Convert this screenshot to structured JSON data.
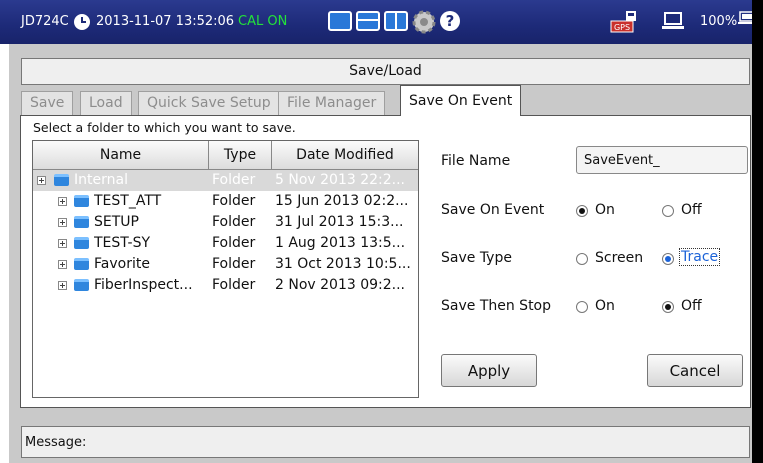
{
  "statusbar": {
    "model": "JD724C",
    "datetime": "2013-11-07 13:52:06",
    "cal": "CAL ON",
    "battery": "100%",
    "icons": [
      "clock-icon",
      "single-view-icon",
      "dual-view-icon",
      "split-view-icon",
      "settings-gear-icon",
      "help-icon",
      "gps-usb-icon",
      "screen-icon",
      "power-icon"
    ]
  },
  "window": {
    "title": "Save/Load"
  },
  "tabs": [
    {
      "label": "Save",
      "active": false
    },
    {
      "label": "Load",
      "active": false
    },
    {
      "label": "Quick Save Setup",
      "active": false
    },
    {
      "label": "File Manager",
      "active": false
    },
    {
      "label": "Save On Event",
      "active": true
    }
  ],
  "instruction": "Select a folder to which you want to save.",
  "tree": {
    "columns": [
      "Name",
      "Type",
      "Date Modified"
    ],
    "rows": [
      {
        "name": "Internal",
        "type": "Folder",
        "date": "5 Nov 2013 22:2...",
        "level": 0,
        "selected": true
      },
      {
        "name": "TEST_ATT",
        "type": "Folder",
        "date": "15 Jun 2013 02:2...",
        "level": 1,
        "selected": false
      },
      {
        "name": "SETUP",
        "type": "Folder",
        "date": "31 Jul 2013 15:3...",
        "level": 1,
        "selected": false
      },
      {
        "name": "TEST-SY",
        "type": "Folder",
        "date": "1 Aug 2013 13:5...",
        "level": 1,
        "selected": false
      },
      {
        "name": "Favorite",
        "type": "Folder",
        "date": "31 Oct 2013 10:5...",
        "level": 1,
        "selected": false
      },
      {
        "name": "FiberInspect...",
        "type": "Folder",
        "date": "2 Nov 2013 09:2...",
        "level": 1,
        "selected": false
      }
    ]
  },
  "form": {
    "file_name_label": "File Name",
    "file_name_value": "SaveEvent_",
    "save_on_event_label": "Save On Event",
    "save_on_event_on": "On",
    "save_on_event_off": "Off",
    "save_type_label": "Save Type",
    "save_type_screen": "Screen",
    "save_type_trace": "Trace",
    "save_then_stop_label": "Save Then Stop",
    "save_then_stop_on": "On",
    "save_then_stop_off": "Off",
    "apply_label": "Apply",
    "cancel_label": "Cancel"
  },
  "message": {
    "label": "Message:"
  },
  "colors": {
    "statusbar": "#1d2a78",
    "cal_on": "#23e23a",
    "accent": "#1c63d8"
  }
}
